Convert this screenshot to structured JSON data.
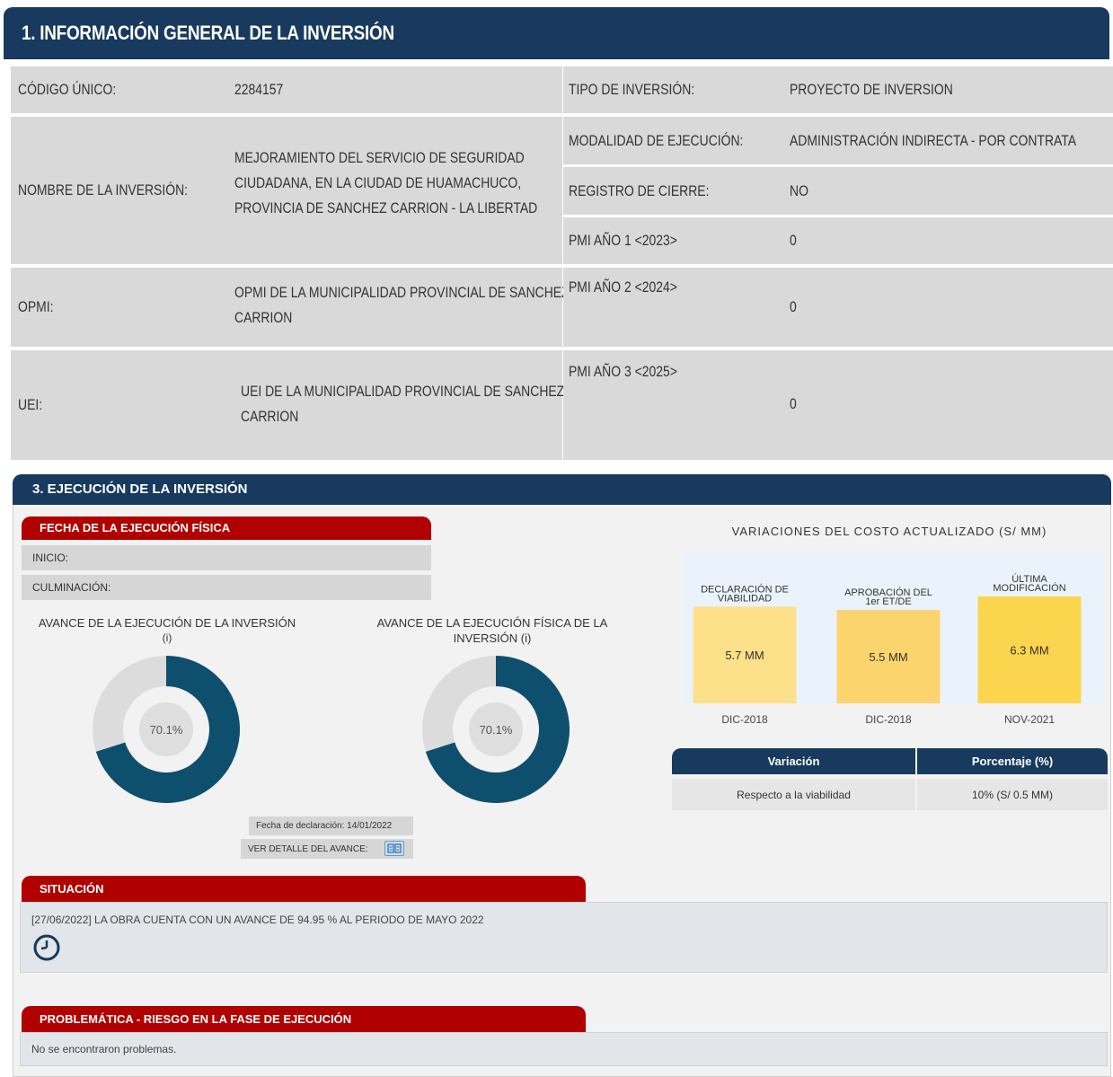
{
  "section1": {
    "title": "1. INFORMACIÓN GENERAL DE LA INVERSIÓN",
    "codigo_label": "CÓDIGO ÚNICO:",
    "codigo_value": "2284157",
    "nombre_label": "NOMBRE DE LA INVERSIÓN:",
    "nombre_lines": [
      "MEJORAMIENTO DEL SERVICIO DE SEGURIDAD",
      "CIUDADANA, EN LA CIUDAD DE HUAMACHUCO,",
      "PROVINCIA DE SANCHEZ CARRION - LA LIBERTAD"
    ],
    "opmi_label": "OPMI:",
    "opmi_lines": [
      "OPMI DE LA MUNICIPALIDAD PROVINCIAL DE SANCHEZ",
      "CARRION"
    ],
    "uei_label": "UEI:",
    "uei_lines": [
      "UEI DE LA MUNICIPALIDAD PROVINCIAL DE SANCHEZ",
      "CARRION"
    ],
    "tipo_label": "TIPO DE INVERSIÓN:",
    "tipo_value": "PROYECTO DE INVERSION",
    "modalidad_label": "MODALIDAD DE EJECUCIÓN:",
    "modalidad_value": "ADMINISTRACIÓN INDIRECTA - POR CONTRATA",
    "registro_label": "REGISTRO DE CIERRE:",
    "registro_value": "NO",
    "pmi1_label": "PMI AÑO 1 <2023>",
    "pmi1_value": "0",
    "pmi2_label": "PMI AÑO 2 <2024>",
    "pmi2_value": "0",
    "pmi3_label": "PMI AÑO 3 <2025>",
    "pmi3_value": "0"
  },
  "section3": {
    "title": "3. EJECUCIÓN DE LA INVERSIÓN",
    "fecha_tab": "FECHA DE LA EJECUCIÓN FÍSICA",
    "inicio_label": "INICIO:",
    "culminacion_label": "CULMINACIÓN:",
    "avance_inversion_label": [
      "AVANCE DE LA EJECUCIÓN DE LA INVERSIÓN",
      "(i)"
    ],
    "avance_fisica_label": [
      "AVANCE DE LA EJECUCIÓN FÍSICA DE LA",
      "INVERSIÓN (i)"
    ],
    "donut1_text": "70.1%",
    "donut1_value": 70.1,
    "donut2_text": "70.1%",
    "donut2_value": 70.1,
    "fecha_declaracion": "Fecha de declaración: 14/01/2022",
    "ver_detalle": "VER DETALLE DEL AVANCE:",
    "situacion_tab": "SITUACIÓN",
    "situacion_text": "[27/06/2022] LA OBRA CUENTA CON UN AVANCE DE 94.95 % AL PERIODO DE MAYO 2022",
    "problematica_tab": "PROBLEMÁTICA - RIESGO EN LA FASE DE EJECUCIÓN",
    "problematica_text": "No se encontraron problemas.",
    "colors": {
      "navy": "#173a5e",
      "red": "#b00000",
      "donut": "#0e4f6e",
      "donut_track": "#dcdcdc",
      "bar1": "#fde08a",
      "bar2": "#fbd46e",
      "bar3": "#fcd54f"
    }
  },
  "variaciones": {
    "title": "VARIACIONES DEL COSTO ACTUALIZADO (S/ MM)",
    "table_headers": [
      "Variación",
      "Porcentaje (%)"
    ],
    "table_row": [
      "Respecto a la viabilidad",
      "10% (S/ 0.5 MM)"
    ]
  },
  "chart_data": {
    "type": "bar",
    "title": "VARIACIONES DEL COSTO ACTUALIZADO (S/ MM)",
    "categories": [
      [
        "DECLARACIÓN DE",
        "VIABILIDAD"
      ],
      [
        "APROBACIÓN DEL",
        "1er ET/DE"
      ],
      [
        "ÚLTIMA",
        "MODIFICACIÓN"
      ]
    ],
    "values": [
      5.7,
      5.5,
      6.3
    ],
    "value_labels": [
      "5.7 MM",
      "5.5 MM",
      "6.3 MM"
    ],
    "dates": [
      "DIC-2018",
      "DIC-2018",
      "NOV-2021"
    ]
  }
}
